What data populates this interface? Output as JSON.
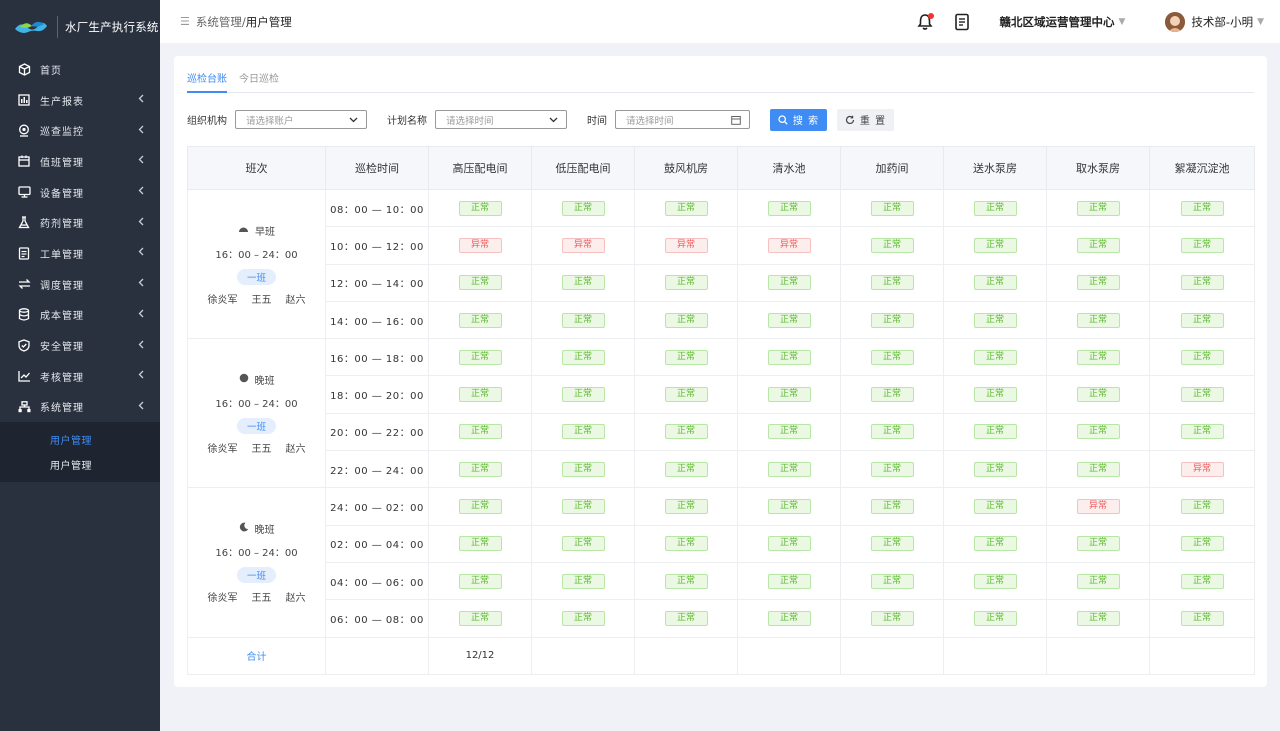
{
  "app": {
    "title": "水厂生产执行系统"
  },
  "sidebar": {
    "items": [
      {
        "label": "首页",
        "icon": "cube-icon",
        "arrow": false
      },
      {
        "label": "生产报表",
        "icon": "bar-chart-icon",
        "arrow": true
      },
      {
        "label": "巡查监控",
        "icon": "location-icon",
        "arrow": true
      },
      {
        "label": "值班管理",
        "icon": "calendar-icon",
        "arrow": true
      },
      {
        "label": "设备管理",
        "icon": "monitor-icon",
        "arrow": true
      },
      {
        "label": "药剂管理",
        "icon": "flask-icon",
        "arrow": true
      },
      {
        "label": "工单管理",
        "icon": "clipboard-icon",
        "arrow": true
      },
      {
        "label": "调度管理",
        "icon": "transfer-icon",
        "arrow": true
      },
      {
        "label": "成本管理",
        "icon": "database-icon",
        "arrow": true
      },
      {
        "label": "安全管理",
        "icon": "shield-icon",
        "arrow": true
      },
      {
        "label": "考核管理",
        "icon": "trend-icon",
        "arrow": true
      },
      {
        "label": "系统管理",
        "icon": "org-tree-icon",
        "arrow": true
      }
    ],
    "submenu": [
      {
        "label": "用户管理",
        "active": true
      },
      {
        "label": "用户管理",
        "active": false
      }
    ]
  },
  "header": {
    "breadcrumb_parent": "系统管理",
    "breadcrumb_sep": " / ",
    "breadcrumb_current": "用户管理",
    "org": "赣北区域运营管理中心",
    "user": "技术部-小明"
  },
  "tabs": [
    {
      "label": "巡检台账",
      "active": true
    },
    {
      "label": "今日巡检",
      "active": false
    }
  ],
  "filters": {
    "org_label": "组织机构",
    "org_placeholder": "请选择账户",
    "plan_label": "计划名称",
    "plan_placeholder": "请选择时间",
    "time_label": "时间",
    "time_placeholder": "请选择时间",
    "search_label": "搜 索",
    "reset_label": "重 置"
  },
  "table": {
    "headers": [
      "班次",
      "巡检时间",
      "高压配电间",
      "低压配电间",
      "鼓风机房",
      "清水池",
      "加药间",
      "送水泵房",
      "取水泵房",
      "絮凝沉淀池"
    ],
    "ok_text": "正常",
    "bad_text": "异常",
    "shifts": [
      {
        "name": "早班",
        "icon": "sunrise-icon",
        "time": "16：00 – 24：00",
        "team": "一班",
        "members": [
          "徐炎军",
          "王五",
          "赵六"
        ],
        "rows": [
          {
            "time": "08：00 — 10：00",
            "status": [
              "ok",
              "ok",
              "ok",
              "ok",
              "ok",
              "ok",
              "ok",
              "ok"
            ]
          },
          {
            "time": "10：00 — 12：00",
            "status": [
              "bad",
              "bad",
              "bad",
              "bad",
              "ok",
              "ok",
              "ok",
              "ok"
            ]
          },
          {
            "time": "12：00 — 14：00",
            "status": [
              "ok",
              "ok",
              "ok",
              "ok",
              "ok",
              "ok",
              "ok",
              "ok"
            ]
          },
          {
            "time": "14：00 — 16：00",
            "status": [
              "ok",
              "ok",
              "ok",
              "ok",
              "ok",
              "ok",
              "ok",
              "ok"
            ]
          }
        ]
      },
      {
        "name": "晚班",
        "icon": "full-moon-icon",
        "time": "16：00 – 24：00",
        "team": "一班",
        "members": [
          "徐炎军",
          "王五",
          "赵六"
        ],
        "rows": [
          {
            "time": "16：00 — 18：00",
            "status": [
              "ok",
              "ok",
              "ok",
              "ok",
              "ok",
              "ok",
              "ok",
              "ok"
            ]
          },
          {
            "time": "18：00 — 20：00",
            "status": [
              "ok",
              "ok",
              "ok",
              "ok",
              "ok",
              "ok",
              "ok",
              "ok"
            ]
          },
          {
            "time": "20：00 — 22：00",
            "status": [
              "ok",
              "ok",
              "ok",
              "ok",
              "ok",
              "ok",
              "ok",
              "ok"
            ]
          },
          {
            "time": "22：00 — 24：00",
            "status": [
              "ok",
              "ok",
              "ok",
              "ok",
              "ok",
              "ok",
              "ok",
              "bad"
            ]
          }
        ]
      },
      {
        "name": "晚班",
        "icon": "crescent-moon-icon",
        "time": "16：00 – 24：00",
        "team": "一班",
        "members": [
          "徐炎军",
          "王五",
          "赵六"
        ],
        "rows": [
          {
            "time": "24：00 — 02：00",
            "status": [
              "ok",
              "ok",
              "ok",
              "ok",
              "ok",
              "ok",
              "bad",
              "ok"
            ]
          },
          {
            "time": "02：00 — 04：00",
            "status": [
              "ok",
              "ok",
              "ok",
              "ok",
              "ok",
              "ok",
              "ok",
              "ok"
            ]
          },
          {
            "time": "04：00 — 06：00",
            "status": [
              "ok",
              "ok",
              "ok",
              "ok",
              "ok",
              "ok",
              "ok",
              "ok"
            ]
          },
          {
            "time": "06：00 — 08：00",
            "status": [
              "ok",
              "ok",
              "ok",
              "ok",
              "ok",
              "ok",
              "ok",
              "ok"
            ]
          }
        ]
      }
    ],
    "total_label": "合计",
    "total_value": "12/12"
  },
  "colors": {
    "accent": "#3f8cf5",
    "sidebar": "#29313f",
    "ok": "#5db82e",
    "bad": "#ee5a5a"
  }
}
